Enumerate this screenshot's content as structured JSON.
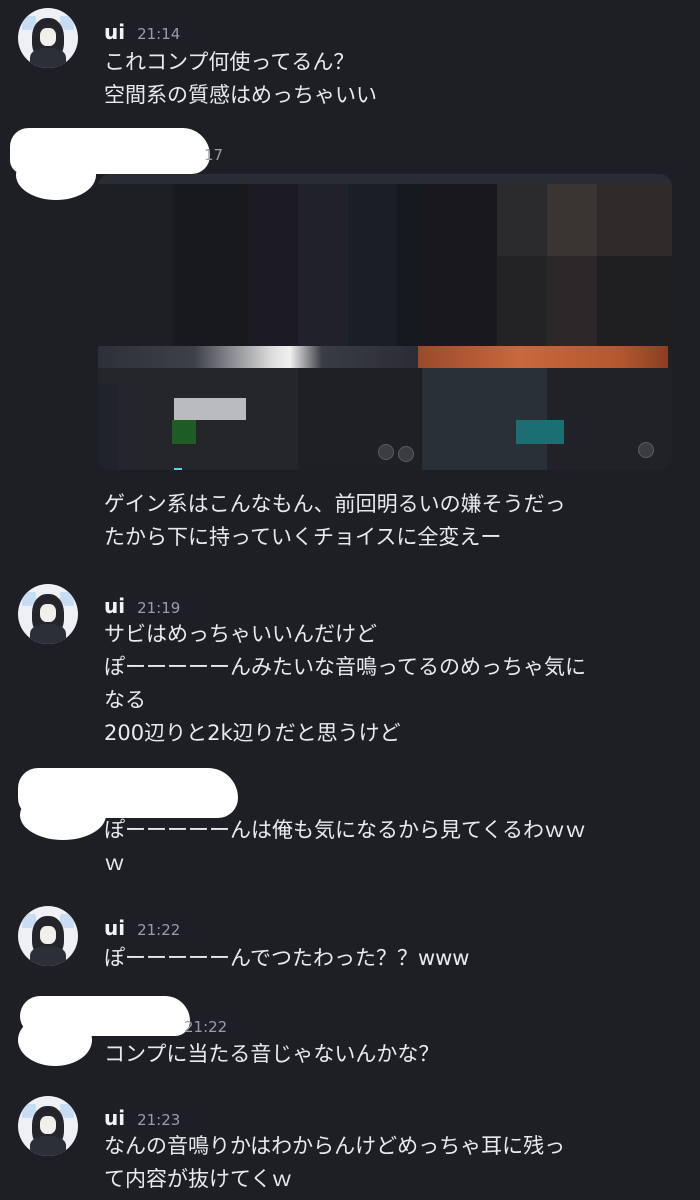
{
  "messages": [
    {
      "name": "ui",
      "time": "21:14",
      "text": "これコンプ何使ってるん？\n空間系の質感はめっちゃいい"
    },
    {
      "time_fragment": "17",
      "text": "ゲイン系はこんなもん、前回明るいの嫌そうだっ\nたから下に持っていくチョイスに全変えー"
    },
    {
      "name": "ui",
      "time": "21:19",
      "text": "サビはめっちゃいいんだけど\nぽーーーーーんみたいな音鳴ってるのめっちゃ気に\nなる\n200辺りと2k辺りだと思うけど"
    },
    {
      "text": "ぽーーーーーんは俺も気になるから見てくるわｗｗ\nｗ"
    },
    {
      "name": "ui",
      "time": "21:22",
      "text": "ぽーーーーーんでつたわった？？www"
    },
    {
      "time_fragment": "21:22",
      "text": "コンプに当たる音じゃないんかな？"
    },
    {
      "name": "ui",
      "time": "21:23",
      "text": "なんの音鳴りかはわからんけどめっちゃ耳に残っ\nて内容が抜けてくｗ"
    }
  ],
  "colors": {
    "background": "#1e1f24",
    "text": "#e9eaee",
    "timestamp": "#9a9ca6",
    "redaction": "#ffffff"
  }
}
